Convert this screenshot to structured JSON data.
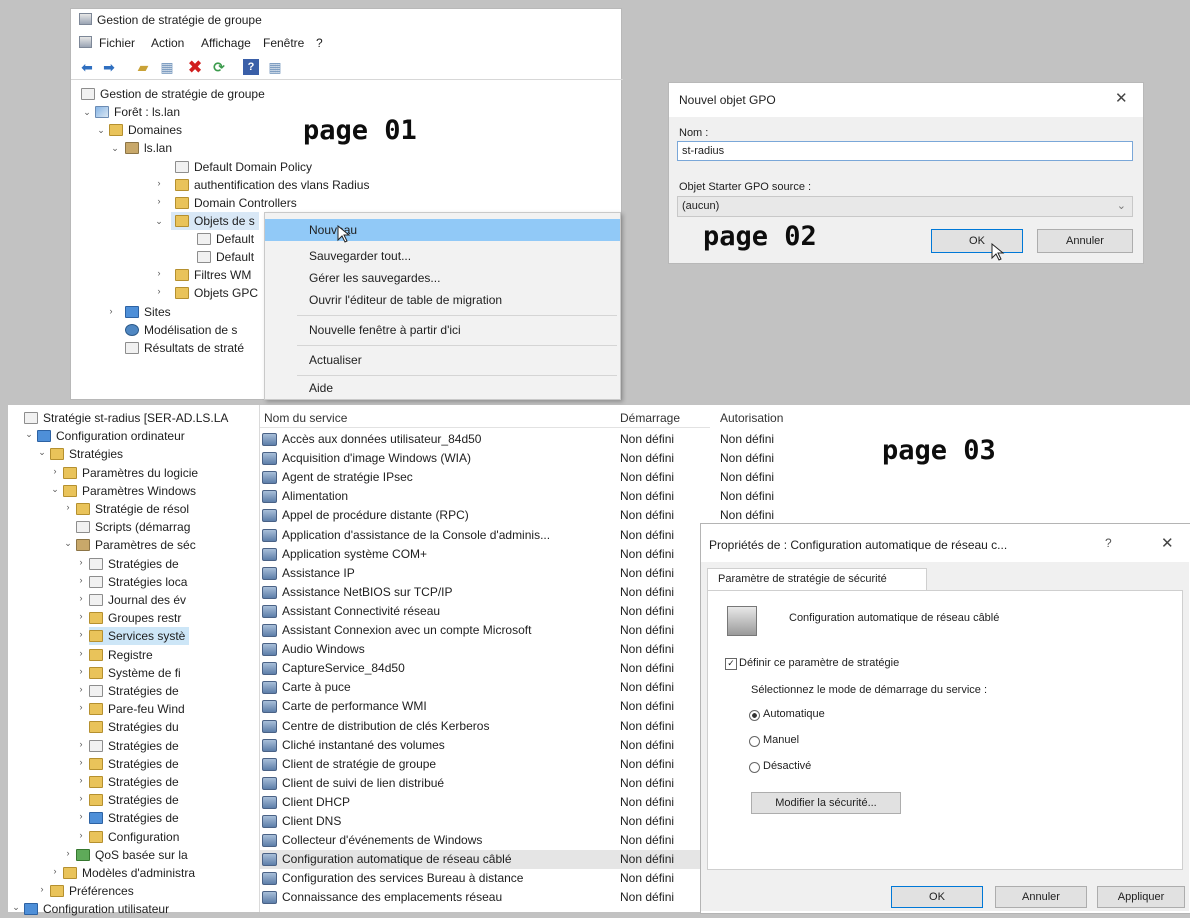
{
  "labels": {
    "p1": "page 01",
    "p2": "page 02",
    "p3": "page 03"
  },
  "gpmc": {
    "title": "Gestion de stratégie de groupe",
    "menu": [
      "Fichier",
      "Action",
      "Affichage",
      "Fenêtre",
      "?"
    ],
    "tree": [
      {
        "label": "Gestion de stratégie de groupe",
        "icon": "gpmc-icon"
      },
      {
        "label": "Forêt : ls.lan",
        "icon": "forest-icon"
      },
      {
        "label": "Domaines",
        "icon": "domains-icon"
      },
      {
        "label": "ls.lan",
        "icon": "domain-icon"
      },
      {
        "label": "Default Domain Policy",
        "icon": "gpo-link-icon"
      },
      {
        "label": "authentification des vlans Radius",
        "icon": "ou-icon"
      },
      {
        "label": "Domain Controllers",
        "icon": "ou-icon"
      },
      {
        "label": "Objets de s",
        "icon": "folder-icon"
      },
      {
        "label": "Default",
        "icon": "gpo-icon"
      },
      {
        "label": "Default",
        "icon": "gpo-icon"
      },
      {
        "label": "Filtres WM",
        "icon": "folder-icon"
      },
      {
        "label": "Objets GPC",
        "icon": "folder-icon"
      },
      {
        "label": "Sites",
        "icon": "sites-icon"
      },
      {
        "label": "Modélisation de s",
        "icon": "modeling-icon"
      },
      {
        "label": "Résultats de straté",
        "icon": "results-icon"
      }
    ],
    "context_menu": [
      "Nouveau",
      "Sauvegarder tout...",
      "Gérer les sauvegardes...",
      "Ouvrir l'éditeur de table de migration",
      "Nouvelle fenêtre à partir d'ici",
      "Actualiser",
      "Aide"
    ]
  },
  "newgpo": {
    "title": "Nouvel objet GPO",
    "close": "✕",
    "name_label": "Nom :",
    "name_value": "st-radius",
    "starter_label": "Objet Starter GPO source :",
    "starter_value": "(aucun)",
    "ok": "OK",
    "cancel": "Annuler"
  },
  "editor": {
    "tree": [
      {
        "label": "Stratégie st-radius [SER-AD.LS.LA",
        "icon": "gpo-icon"
      },
      {
        "label": "Configuration ordinateur",
        "icon": "computer-icon"
      },
      {
        "label": "Stratégies",
        "icon": "folder-icon"
      },
      {
        "label": "Paramètres du logicie",
        "icon": "folder-icon"
      },
      {
        "label": "Paramètres Windows",
        "icon": "folder-icon"
      },
      {
        "label": "Stratégie de résol",
        "icon": "folder-icon"
      },
      {
        "label": "Scripts (démarrag",
        "icon": "scripts-icon"
      },
      {
        "label": "Paramètres de séc",
        "icon": "security-icon"
      },
      {
        "label": "Stratégies de",
        "icon": "policy-icon"
      },
      {
        "label": "Stratégies loca",
        "icon": "policy-icon"
      },
      {
        "label": "Journal des év",
        "icon": "policy-icon"
      },
      {
        "label": "Groupes restr",
        "icon": "folder-icon"
      },
      {
        "label": "Services systè",
        "icon": "folder-icon"
      },
      {
        "label": "Registre",
        "icon": "folder-icon"
      },
      {
        "label": "Système de fi",
        "icon": "folder-icon"
      },
      {
        "label": "Stratégies de",
        "icon": "policy-icon"
      },
      {
        "label": "Pare-feu Wind",
        "icon": "folder-icon"
      },
      {
        "label": "Stratégies du",
        "icon": "folder-icon"
      },
      {
        "label": "Stratégies de",
        "icon": "policy-icon"
      },
      {
        "label": "Stratégies de",
        "icon": "folder-icon"
      },
      {
        "label": "Stratégies de",
        "icon": "folder-icon"
      },
      {
        "label": "Stratégies de",
        "icon": "folder-icon"
      },
      {
        "label": "Stratégies de",
        "icon": "server-icon"
      },
      {
        "label": "Configuration",
        "icon": "folder-icon"
      },
      {
        "label": "QoS basée sur la",
        "icon": "chart-icon"
      },
      {
        "label": "Modèles d'administra",
        "icon": "folder-icon"
      },
      {
        "label": "Préférences",
        "icon": "folder-icon"
      },
      {
        "label": "Configuration utilisateur",
        "icon": "user-icon"
      }
    ],
    "columns": [
      "Nom du service",
      "Démarrage",
      "Autorisation"
    ],
    "services": [
      {
        "name": "Accès aux données utilisateur_84d50",
        "start": "Non défini",
        "auth": "Non défini"
      },
      {
        "name": "Acquisition d'image Windows (WIA)",
        "start": "Non défini",
        "auth": "Non défini"
      },
      {
        "name": "Agent de stratégie IPsec",
        "start": "Non défini",
        "auth": "Non défini"
      },
      {
        "name": "Alimentation",
        "start": "Non défini",
        "auth": "Non défini"
      },
      {
        "name": "Appel de procédure distante (RPC)",
        "start": "Non défini",
        "auth": "Non défini"
      },
      {
        "name": "Application d'assistance de la Console d'adminis...",
        "start": "Non défini",
        "auth": ""
      },
      {
        "name": "Application système COM+",
        "start": "Non défini",
        "auth": ""
      },
      {
        "name": "Assistance IP",
        "start": "Non défini",
        "auth": ""
      },
      {
        "name": "Assistance NetBIOS sur TCP/IP",
        "start": "Non défini",
        "auth": ""
      },
      {
        "name": "Assistant Connectivité réseau",
        "start": "Non défini",
        "auth": ""
      },
      {
        "name": "Assistant Connexion avec un compte Microsoft",
        "start": "Non défini",
        "auth": ""
      },
      {
        "name": "Audio Windows",
        "start": "Non défini",
        "auth": ""
      },
      {
        "name": "CaptureService_84d50",
        "start": "Non défini",
        "auth": ""
      },
      {
        "name": "Carte à puce",
        "start": "Non défini",
        "auth": ""
      },
      {
        "name": "Carte de performance WMI",
        "start": "Non défini",
        "auth": ""
      },
      {
        "name": "Centre de distribution de clés Kerberos",
        "start": "Non défini",
        "auth": ""
      },
      {
        "name": "Cliché instantané des volumes",
        "start": "Non défini",
        "auth": ""
      },
      {
        "name": "Client de stratégie de groupe",
        "start": "Non défini",
        "auth": ""
      },
      {
        "name": "Client de suivi de lien distribué",
        "start": "Non défini",
        "auth": ""
      },
      {
        "name": "Client DHCP",
        "start": "Non défini",
        "auth": ""
      },
      {
        "name": "Client DNS",
        "start": "Non défini",
        "auth": ""
      },
      {
        "name": "Collecteur d'événements de Windows",
        "start": "Non défini",
        "auth": ""
      },
      {
        "name": "Configuration automatique de réseau câblé",
        "start": "Non défini",
        "auth": ""
      },
      {
        "name": "Configuration des services Bureau à distance",
        "start": "Non défini",
        "auth": ""
      },
      {
        "name": "Connaissance des emplacements réseau",
        "start": "Non défini",
        "auth": ""
      }
    ]
  },
  "props": {
    "title": "Propriétés de : Configuration automatique de réseau c...",
    "help": "?",
    "close": "✕",
    "tab": "Paramètre de stratégie de sécurité",
    "service_name": "Configuration automatique de réseau câblé",
    "define_label": "Définir ce paramètre de stratégie",
    "mode_label": "Sélectionnez le mode de démarrage du service :",
    "options": [
      "Automatique",
      "Manuel",
      "Désactivé"
    ],
    "selected_option": "Automatique",
    "security_btn": "Modifier la sécurité...",
    "ok": "OK",
    "cancel": "Annuler",
    "apply": "Appliquer"
  }
}
